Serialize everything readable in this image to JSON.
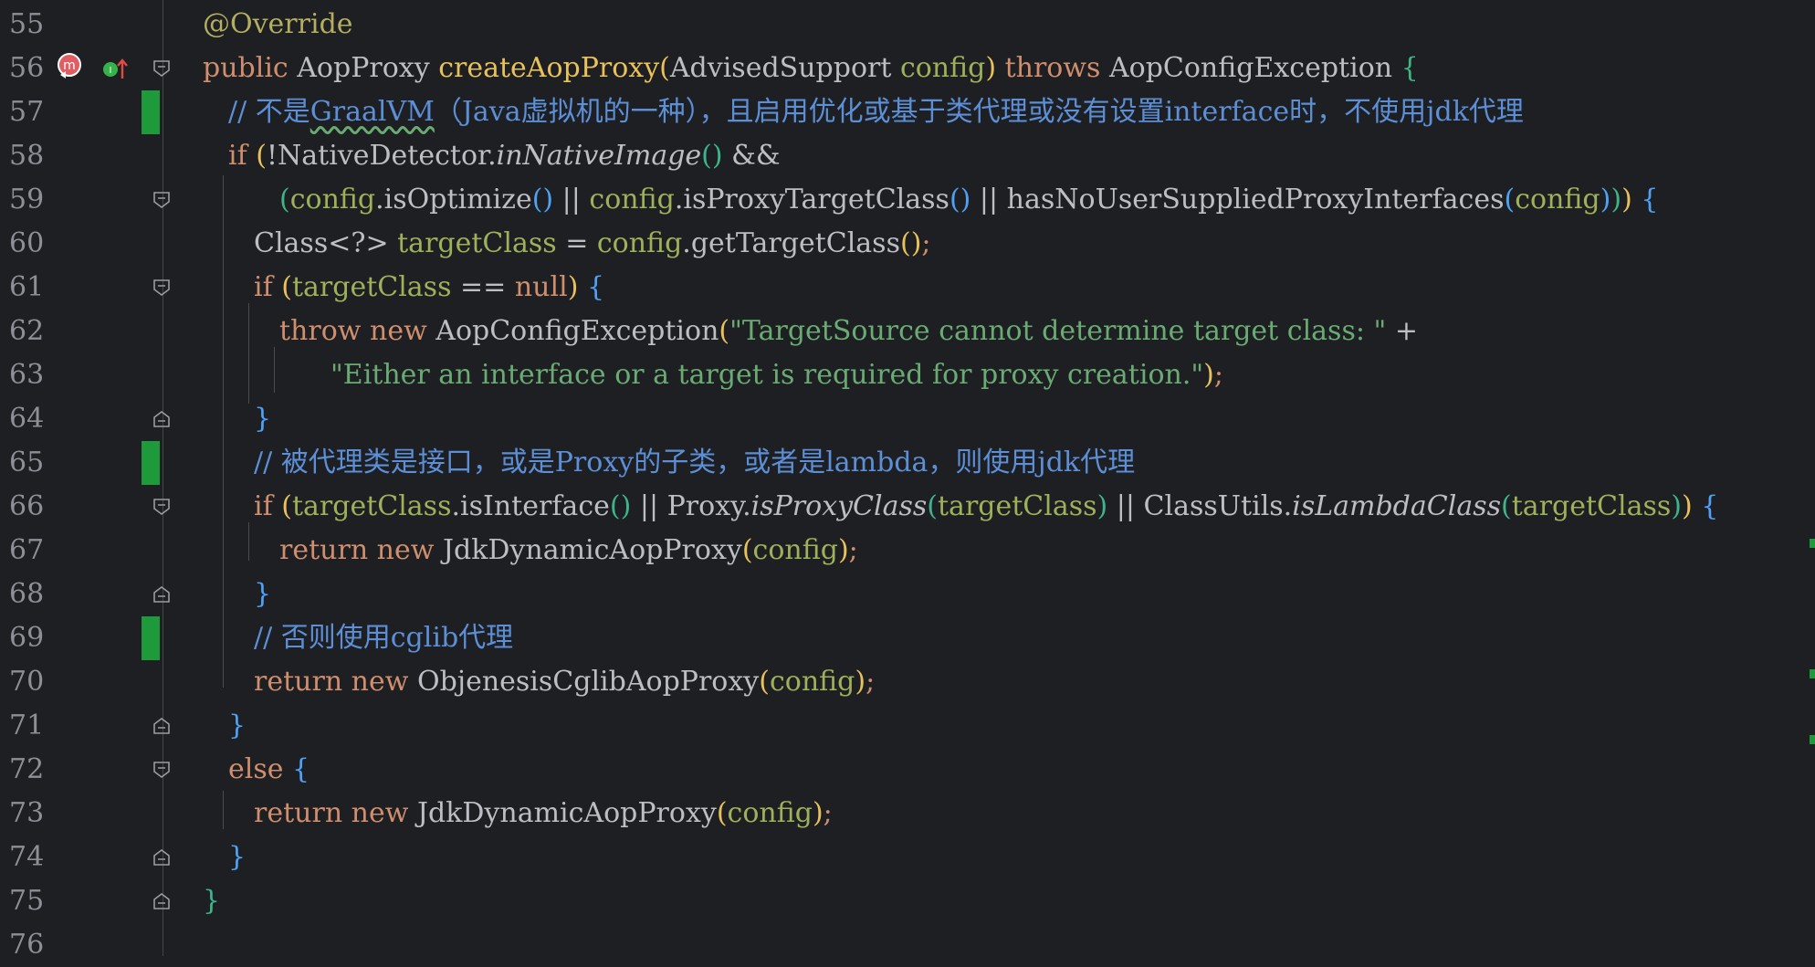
{
  "editor": {
    "lines": [
      {
        "n": "55",
        "tokens": [
          {
            "t": "@Override",
            "c": "t-ann"
          }
        ]
      },
      {
        "n": "56",
        "tokens": [
          {
            "t": "public ",
            "c": "t-kw"
          },
          {
            "t": "AopProxy ",
            "c": "t-plain"
          },
          {
            "t": "createAopProxy",
            "c": "t-fn"
          },
          {
            "t": "(",
            "c": "p1"
          },
          {
            "t": "AdvisedSupport ",
            "c": "t-plain"
          },
          {
            "t": "config",
            "c": "t-param"
          },
          {
            "t": ") ",
            "c": "p1"
          },
          {
            "t": "throws ",
            "c": "t-kw"
          },
          {
            "t": "AopConfigException ",
            "c": "t-plain"
          },
          {
            "t": "{",
            "c": "p2"
          }
        ]
      },
      {
        "n": "57",
        "tokens": [
          {
            "t": "// 不是",
            "c": "t-cmt"
          },
          {
            "t": "GraalVM",
            "c": "t-cmt wavy"
          },
          {
            "t": "（Java虚拟机的一种），且启用优化或基于类代理或没有设置interface时，不使用jdk代理",
            "c": "t-cmt"
          }
        ]
      },
      {
        "n": "58",
        "tokens": [
          {
            "t": "if ",
            "c": "t-kw"
          },
          {
            "t": "(",
            "c": "p1"
          },
          {
            "t": "!NativeDetector.",
            "c": "t-plain"
          },
          {
            "t": "inNativeImage",
            "c": "t-plain t-ital"
          },
          {
            "t": "()",
            "c": "p2"
          },
          {
            "t": " &&",
            "c": "t-plain"
          }
        ]
      },
      {
        "n": "59",
        "tokens": [
          {
            "t": "(",
            "c": "p2"
          },
          {
            "t": "config",
            "c": "t-param"
          },
          {
            "t": ".isOptimize",
            "c": "t-plain"
          },
          {
            "t": "()",
            "c": "p3"
          },
          {
            "t": " || ",
            "c": "t-plain"
          },
          {
            "t": "config",
            "c": "t-param"
          },
          {
            "t": ".isProxyTargetClass",
            "c": "t-plain"
          },
          {
            "t": "()",
            "c": "p3"
          },
          {
            "t": " || hasNoUserSuppliedProxyInterfaces",
            "c": "t-plain"
          },
          {
            "t": "(",
            "c": "p3"
          },
          {
            "t": "config",
            "c": "t-param"
          },
          {
            "t": ")",
            "c": "p3"
          },
          {
            "t": ")",
            "c": "p2"
          },
          {
            "t": ")",
            "c": "p1"
          },
          {
            "t": " {",
            "c": "p3"
          }
        ]
      },
      {
        "n": "60",
        "tokens": [
          {
            "t": "Class",
            "c": "t-plain"
          },
          {
            "t": "<?>",
            "c": "t-plain"
          },
          {
            "t": " targetClass",
            "c": "t-param"
          },
          {
            "t": " = ",
            "c": "t-plain"
          },
          {
            "t": "config",
            "c": "t-param"
          },
          {
            "t": ".getTargetClass",
            "c": "t-plain"
          },
          {
            "t": "()",
            "c": "p1"
          },
          {
            "t": ";",
            "c": "t-kw"
          }
        ]
      },
      {
        "n": "61",
        "tokens": [
          {
            "t": "if ",
            "c": "t-kw"
          },
          {
            "t": "(",
            "c": "p1"
          },
          {
            "t": "targetClass",
            "c": "t-param"
          },
          {
            "t": " == ",
            "c": "t-plain"
          },
          {
            "t": "null",
            "c": "t-kw"
          },
          {
            "t": ")",
            "c": "p1"
          },
          {
            "t": " {",
            "c": "p3"
          }
        ]
      },
      {
        "n": "62",
        "tokens": [
          {
            "t": "throw new ",
            "c": "t-kw"
          },
          {
            "t": "AopConfigException",
            "c": "t-plain"
          },
          {
            "t": "(",
            "c": "p1"
          },
          {
            "t": "\"TargetSource cannot determine target class: \"",
            "c": "t-str"
          },
          {
            "t": " +",
            "c": "t-plain"
          }
        ]
      },
      {
        "n": "63",
        "tokens": [
          {
            "t": "\"Either an interface or a target is required for proxy creation.\"",
            "c": "t-str"
          },
          {
            "t": ")",
            "c": "p1"
          },
          {
            "t": ";",
            "c": "t-kw"
          }
        ]
      },
      {
        "n": "64",
        "tokens": [
          {
            "t": "}",
            "c": "p3"
          }
        ]
      },
      {
        "n": "65",
        "tokens": [
          {
            "t": "// 被代理类是接口，或是Proxy的子类，或者是lambda，则使用jdk代理",
            "c": "t-cmt"
          }
        ]
      },
      {
        "n": "66",
        "tokens": [
          {
            "t": "if ",
            "c": "t-kw"
          },
          {
            "t": "(",
            "c": "p1"
          },
          {
            "t": "targetClass",
            "c": "t-param"
          },
          {
            "t": ".isInterface",
            "c": "t-plain"
          },
          {
            "t": "()",
            "c": "p2"
          },
          {
            "t": " || Proxy.",
            "c": "t-plain"
          },
          {
            "t": "isProxyClass",
            "c": "t-plain t-ital"
          },
          {
            "t": "(",
            "c": "p2"
          },
          {
            "t": "targetClass",
            "c": "t-param"
          },
          {
            "t": ")",
            "c": "p2"
          },
          {
            "t": " || ClassUtils.",
            "c": "t-plain"
          },
          {
            "t": "isLambdaClass",
            "c": "t-plain t-ital"
          },
          {
            "t": "(",
            "c": "p2"
          },
          {
            "t": "targetClass",
            "c": "t-param"
          },
          {
            "t": ")",
            "c": "p2"
          },
          {
            "t": ")",
            "c": "p1"
          },
          {
            "t": " {",
            "c": "p3"
          }
        ]
      },
      {
        "n": "67",
        "tokens": [
          {
            "t": "return new ",
            "c": "t-kw"
          },
          {
            "t": "JdkDynamicAopProxy",
            "c": "t-plain"
          },
          {
            "t": "(",
            "c": "p1"
          },
          {
            "t": "config",
            "c": "t-param"
          },
          {
            "t": ")",
            "c": "p1"
          },
          {
            "t": ";",
            "c": "t-kw"
          }
        ]
      },
      {
        "n": "68",
        "tokens": [
          {
            "t": "}",
            "c": "p3"
          }
        ]
      },
      {
        "n": "69",
        "tokens": [
          {
            "t": "// 否则使用cglib代理",
            "c": "t-cmt"
          }
        ]
      },
      {
        "n": "70",
        "tokens": [
          {
            "t": "return new ",
            "c": "t-kw"
          },
          {
            "t": "ObjenesisCglibAopProxy",
            "c": "t-plain"
          },
          {
            "t": "(",
            "c": "p1"
          },
          {
            "t": "config",
            "c": "t-param"
          },
          {
            "t": ")",
            "c": "p1"
          },
          {
            "t": ";",
            "c": "t-kw"
          }
        ]
      },
      {
        "n": "71",
        "tokens": [
          {
            "t": "}",
            "c": "p3"
          }
        ]
      },
      {
        "n": "72",
        "tokens": [
          {
            "t": "else ",
            "c": "t-kw"
          },
          {
            "t": "{",
            "c": "p3"
          }
        ]
      },
      {
        "n": "73",
        "tokens": [
          {
            "t": "return new ",
            "c": "t-kw"
          },
          {
            "t": "JdkDynamicAopProxy",
            "c": "t-plain"
          },
          {
            "t": "(",
            "c": "p1"
          },
          {
            "t": "config",
            "c": "t-param"
          },
          {
            "t": ")",
            "c": "p1"
          },
          {
            "t": ";",
            "c": "t-kw"
          }
        ]
      },
      {
        "n": "74",
        "tokens": [
          {
            "t": "}",
            "c": "p3"
          }
        ]
      },
      {
        "n": "75",
        "tokens": [
          {
            "t": "}",
            "c": "p2"
          }
        ]
      },
      {
        "n": "76",
        "tokens": []
      }
    ],
    "gutter_icons": {
      "line_56_markers": [
        "method-marker-icon",
        "implements-up-arrow-icon"
      ],
      "change_marker_color": "#1f9a3a"
    }
  }
}
